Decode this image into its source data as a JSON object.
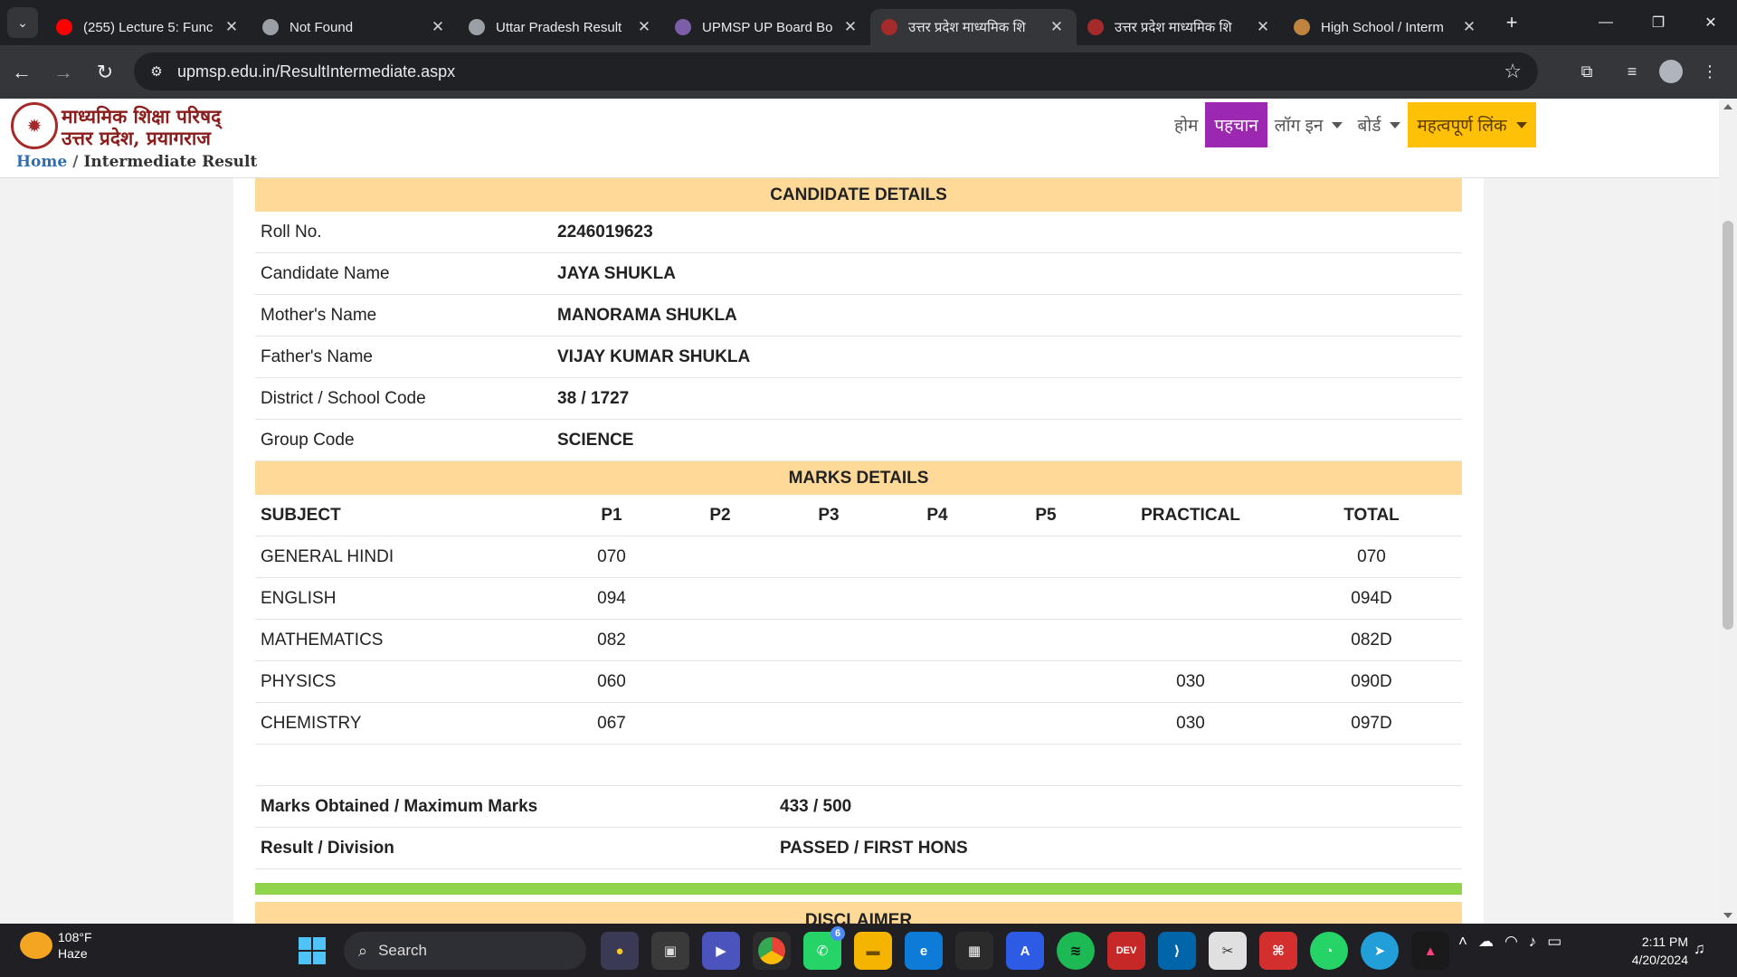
{
  "browser": {
    "tabs": [
      {
        "title": "(255) Lecture 5: Func",
        "favicon": "youtube-icon",
        "color": "#ff0000",
        "active": false
      },
      {
        "title": "Not Found",
        "favicon": "globe-icon",
        "color": "#9aa0a6",
        "active": false
      },
      {
        "title": "Uttar Pradesh Result",
        "favicon": "globe-icon",
        "color": "#9aa0a6",
        "active": false
      },
      {
        "title": "UPMSP UP Board Bo",
        "favicon": "upmsp-icon",
        "color": "#7b5ea7",
        "active": false
      },
      {
        "title": "उत्तर प्रदेश माध्यमिक शि",
        "favicon": "up-emblem-icon",
        "color": "#a52a2a",
        "active": true
      },
      {
        "title": "उत्तर प्रदेश माध्यमिक शि",
        "favicon": "up-emblem-icon",
        "color": "#a52a2a",
        "active": false
      },
      {
        "title": "High School / Interm",
        "favicon": "seal-icon",
        "color": "#c0843e",
        "active": false
      }
    ],
    "url": "upmsp.edu.in/ResultIntermediate.aspx"
  },
  "site": {
    "brand_line1": "माध्यमिक शिक्षा परिषद्",
    "brand_line2": "उत्तर प्रदेश, प्रयागराज",
    "nav": {
      "home": "होम",
      "pehchan": "पहचान",
      "login": "लॉग इन",
      "board": "बोर्ड",
      "links": "महत्वपूर्ण लिंक"
    },
    "breadcrumb": {
      "home": "Home",
      "sep": "/",
      "current": "Intermediate Result"
    }
  },
  "result": {
    "candidate_heading": "CANDIDATE DETAILS",
    "candidate": [
      {
        "label": "Roll No.",
        "value": "2246019623"
      },
      {
        "label": "Candidate Name",
        "value": "JAYA SHUKLA"
      },
      {
        "label": "Mother's Name",
        "value": "MANORAMA SHUKLA"
      },
      {
        "label": "Father's Name",
        "value": "VIJAY KUMAR SHUKLA"
      },
      {
        "label": "District / School Code",
        "value": "38 / 1727"
      },
      {
        "label": "Group Code",
        "value": "SCIENCE"
      }
    ],
    "marks_heading": "MARKS DETAILS",
    "marks_columns": [
      "SUBJECT",
      "P1",
      "P2",
      "P3",
      "P4",
      "P5",
      "PRACTICAL",
      "TOTAL"
    ],
    "marks_rows": [
      [
        "GENERAL HINDI",
        "070",
        "",
        "",
        "",
        "",
        "",
        "070"
      ],
      [
        "ENGLISH",
        "094",
        "",
        "",
        "",
        "",
        "",
        "094D"
      ],
      [
        "MATHEMATICS",
        "082",
        "",
        "",
        "",
        "",
        "",
        "082D"
      ],
      [
        "PHYSICS",
        "060",
        "",
        "",
        "",
        "",
        "030",
        "090D"
      ],
      [
        "CHEMISTRY",
        "067",
        "",
        "",
        "",
        "",
        "030",
        "097D"
      ]
    ],
    "summary": [
      {
        "label": "Marks Obtained / Maximum Marks",
        "value": "433 / 500"
      },
      {
        "label": "Result / Division",
        "value": "PASSED / FIRST HONS"
      }
    ],
    "disclaimer_heading": "DISCLAIMER"
  },
  "taskbar": {
    "temp": "108°F",
    "condition": "Haze",
    "search_placeholder": "Search",
    "time": "2:11 PM",
    "date": "4/20/2024",
    "chrome_badge": "6"
  },
  "colors": {
    "section_band": "#ffd998",
    "pehchan_bg": "#9c27b0",
    "links_bg": "#ffc107",
    "result_bar": "#8fd44a"
  }
}
